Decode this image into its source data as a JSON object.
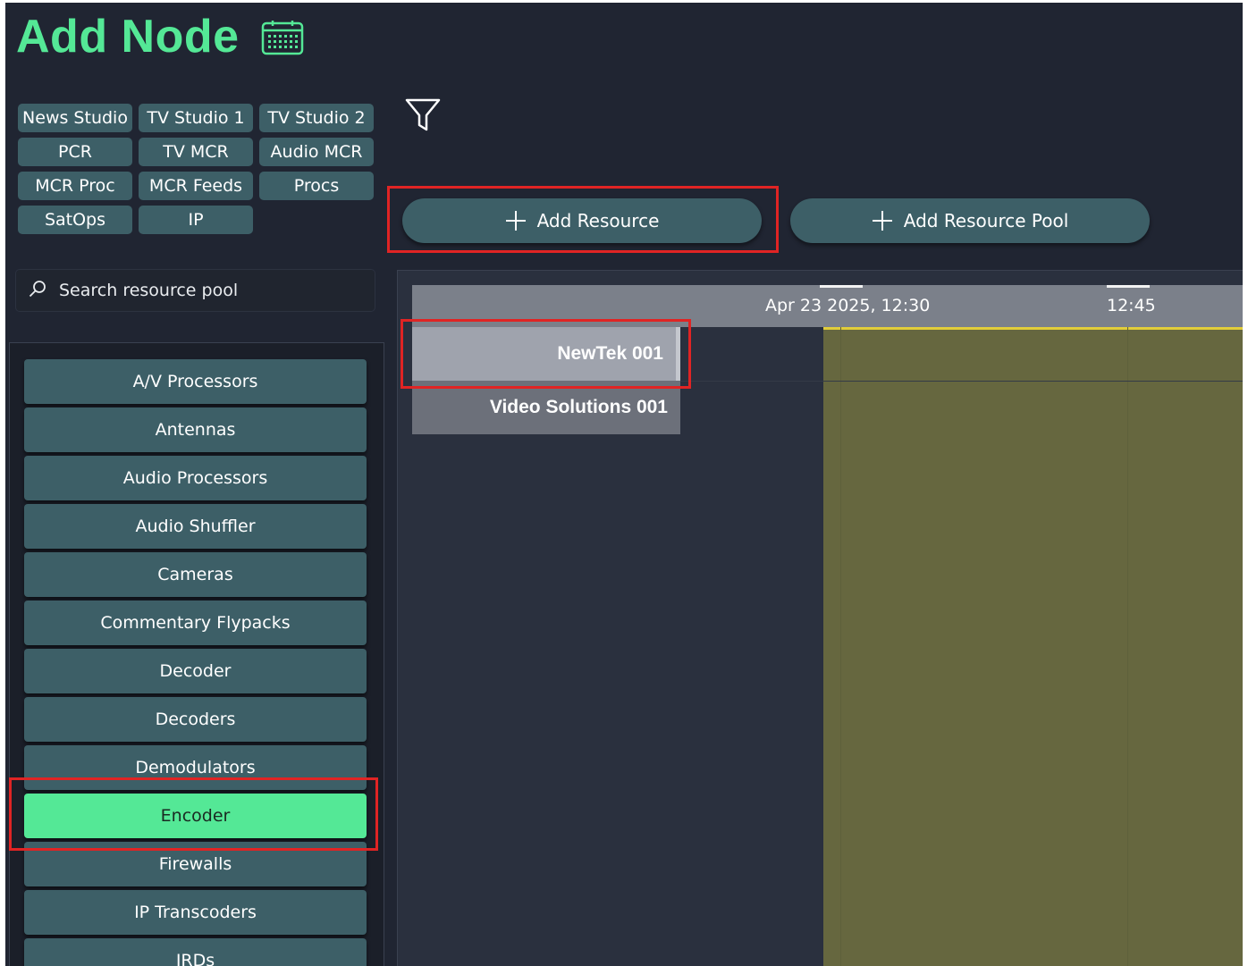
{
  "page": {
    "title": "Add Node"
  },
  "icons": {
    "calendar": "calendar-icon",
    "filter": "filter-icon",
    "search": "search-icon",
    "plus": "plus-icon"
  },
  "colors": {
    "accent_green": "#54e896",
    "button_teal": "#3d5f67",
    "highlight_red": "#e02424",
    "now_band": "#66673f",
    "now_line": "#e1cd3a",
    "background": "#202532"
  },
  "studios": [
    {
      "label": "News Studio"
    },
    {
      "label": "TV Studio 1"
    },
    {
      "label": "TV Studio 2"
    },
    {
      "label": "PCR"
    },
    {
      "label": "TV MCR"
    },
    {
      "label": "Audio MCR"
    },
    {
      "label": "MCR Proc"
    },
    {
      "label": "MCR Feeds"
    },
    {
      "label": "Procs"
    },
    {
      "label": "SatOps"
    },
    {
      "label": "IP"
    }
  ],
  "actions": {
    "add_resource": "Add Resource",
    "add_resource_pool": "Add Resource Pool"
  },
  "search": {
    "placeholder": "Search resource pool",
    "value": ""
  },
  "categories": [
    {
      "label": "A/V Processors"
    },
    {
      "label": "Antennas"
    },
    {
      "label": "Audio Processors"
    },
    {
      "label": "Audio Shuffler"
    },
    {
      "label": "Cameras"
    },
    {
      "label": "Commentary Flypacks"
    },
    {
      "label": "Decoder"
    },
    {
      "label": "Decoders"
    },
    {
      "label": "Demodulators"
    },
    {
      "label": "Encoder",
      "selected": true
    },
    {
      "label": "Firewalls"
    },
    {
      "label": "IP Transcoders"
    },
    {
      "label": "IRDs"
    }
  ],
  "timeline": {
    "ticks": [
      "Apr 23 2025, 12:30",
      "12:45"
    ],
    "resources": [
      {
        "label": "NewTek 001",
        "highlighted": true
      },
      {
        "label": "Video Solutions 001"
      }
    ]
  }
}
